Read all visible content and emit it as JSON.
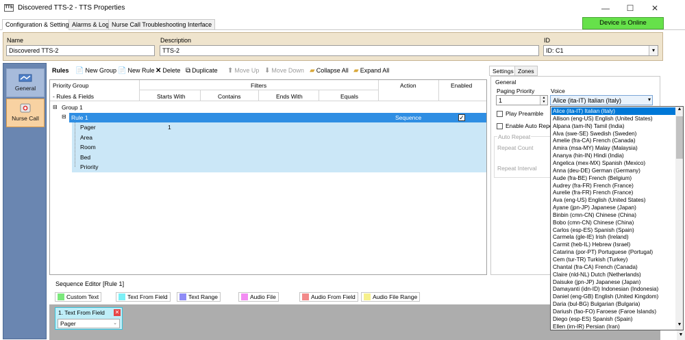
{
  "window": {
    "app_icon_text": "TTS",
    "title": "Discovered TTS-2 - TTS Properties",
    "minimize": "—",
    "maximize": "☐",
    "close": "✕"
  },
  "tabs": [
    "Configuration & Settings",
    "Alarms & Logs",
    "Nurse Call Troubleshooting Interface"
  ],
  "status": {
    "label": "Device is Online",
    "color": "#66e14a"
  },
  "header": {
    "name_label": "Name",
    "name_value": "Discovered TTS-2",
    "description_label": "Description",
    "description_value": "TTS-2",
    "id_label": "ID",
    "id_value": "ID: C1"
  },
  "nav": [
    {
      "label": "General",
      "icon": "network-icon"
    },
    {
      "label": "Nurse Call",
      "icon": "nurse-call-icon"
    }
  ],
  "rules_toolbar": {
    "title": "Rules",
    "new_group": "New Group",
    "new_rule": "New Rule",
    "delete": "Delete",
    "duplicate": "Duplicate",
    "move_up": "Move Up",
    "move_down": "Move Down",
    "collapse_all": "Collapse All",
    "expand_all": "Expand All"
  },
  "grid": {
    "col_priority_group": "Priority Group",
    "col_rules_fields": "- Rules & Fields",
    "col_filters": "Filters",
    "col_starts_with": "Starts With",
    "col_contains": "Contains",
    "col_ends_with": "Ends With",
    "col_equals": "Equals",
    "col_action": "Action",
    "col_enabled": "Enabled",
    "group": "Group 1",
    "rule": "Rule 1",
    "rule_action": "Sequence",
    "rule_enabled_check": "✓",
    "fields": [
      {
        "name": "Pager",
        "starts_with": "1"
      },
      {
        "name": "Area",
        "starts_with": ""
      },
      {
        "name": "Room",
        "starts_with": ""
      },
      {
        "name": "Bed",
        "starts_with": ""
      },
      {
        "name": "Priority",
        "starts_with": ""
      }
    ]
  },
  "settings": {
    "tab_settings": "Settings",
    "tab_zones": "Zones",
    "general": "General",
    "paging_priority_label": "Paging Priority",
    "paging_priority_value": "1",
    "voice_label": "Voice",
    "voice_value": "Alice (ita-IT) Italian (Italy)",
    "play_preamble": "Play Preamble",
    "enable_auto_repeat": "Enable Auto Repea",
    "auto_repeat": "Auto Repeat",
    "repeat_count": "Repeat Count",
    "repeat_interval": "Repeat Interval"
  },
  "voice_options": [
    "Alice (ita-IT) Italian (Italy)",
    "Allison (eng-US) English (United States)",
    "Alpana (tam-IN) Tamil (India)",
    "Alva (swe-SE) Swedish (Sweden)",
    "Amelie (fra-CA) French (Canada)",
    "Amira (msa-MY) Malay (Malaysia)",
    "Ananya (hin-IN) Hindi (India)",
    "Angelica (mex-MX) Spanish (Mexico)",
    "Anna (deu-DE) German (Germany)",
    "Aude (fra-BE) French (Belgium)",
    "Audrey (fra-FR) French (France)",
    "Aurelie (fra-FR) French (France)",
    "Ava (eng-US) English (United States)",
    "Ayane (jpn-JP) Japanese (Japan)",
    "Binbin (cmn-CN) Chinese (China)",
    "Bobo (cmn-CN) Chinese (China)",
    "Carlos (esp-ES) Spanish (Spain)",
    "Carmela (gle-IE) Irish (Ireland)",
    "Carmit (heb-IL) Hebrew (Israel)",
    "Catarina (por-PT) Portuguese (Portugal)",
    "Cem (tur-TR) Turkish (Turkey)",
    "Chantal (fra-CA) French (Canada)",
    "Claire (nld-NL) Dutch (Netherlands)",
    "Daisuke (jpn-JP) Japanese (Japan)",
    "Damayanti (idn-ID) Indonesian (Indonesia)",
    "Daniel (eng-GB) English (United Kingdom)",
    "Daria (bul-BG) Bulgarian (Bulgaria)",
    "Dariush (fao-FO) Faroese (Faroe Islands)",
    "Diego (esp-ES) Spanish (Spain)",
    "Ellen (irn-IR) Persian (Iran)"
  ],
  "sequence": {
    "title": "Sequence Editor [Rule 1]",
    "legend": [
      {
        "label": "Custom Text",
        "color": "#7ce87c"
      },
      {
        "label": "Text From Field",
        "color": "#7cf0f6"
      },
      {
        "label": "Text Range",
        "color": "#8f8cf6"
      },
      {
        "label": "Audio File",
        "color": "#f28cf2"
      },
      {
        "label": "Audio From Field",
        "color": "#f28a8a"
      },
      {
        "label": "Audio File Range",
        "color": "#f6f08c"
      }
    ],
    "card_title": "1. Text From Field",
    "card_value": "Pager"
  }
}
